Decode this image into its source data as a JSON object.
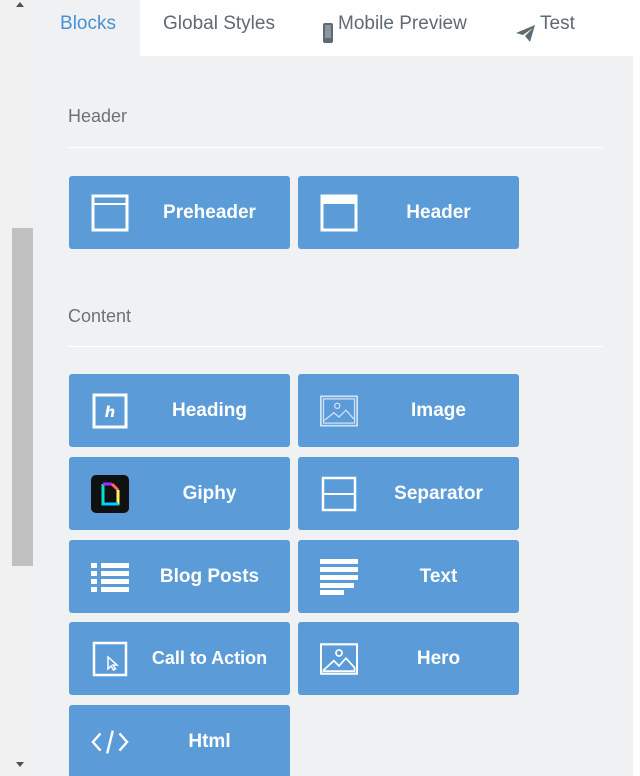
{
  "tabs": [
    {
      "label": "Blocks",
      "active": true
    },
    {
      "label": "Global Styles",
      "active": false
    },
    {
      "label": "Mobile Preview",
      "active": false,
      "icon": "phone-icon"
    },
    {
      "label": "Test",
      "active": false,
      "icon": "paper-plane-icon"
    }
  ],
  "sections": {
    "header": {
      "title": "Header",
      "blocks": [
        {
          "label": "Preheader",
          "icon": "preheader-icon"
        },
        {
          "label": "Header",
          "icon": "header-icon"
        }
      ]
    },
    "content": {
      "title": "Content",
      "blocks": [
        {
          "label": "Heading",
          "icon": "heading-icon"
        },
        {
          "label": "Image",
          "icon": "image-icon"
        },
        {
          "label": "Giphy",
          "icon": "giphy-icon"
        },
        {
          "label": "Separator",
          "icon": "separator-icon"
        },
        {
          "label": "Blog Posts",
          "icon": "list-icon"
        },
        {
          "label": "Text",
          "icon": "text-lines-icon"
        },
        {
          "label": "Call to Action",
          "icon": "cursor-icon"
        },
        {
          "label": "Hero",
          "icon": "hero-image-icon"
        },
        {
          "label": "Html",
          "icon": "code-icon"
        }
      ]
    }
  },
  "colors": {
    "accent": "#4a90d6",
    "block_bg": "#5b9bd8",
    "panel_bg": "#eff1f2",
    "text_muted": "#6b7378"
  }
}
